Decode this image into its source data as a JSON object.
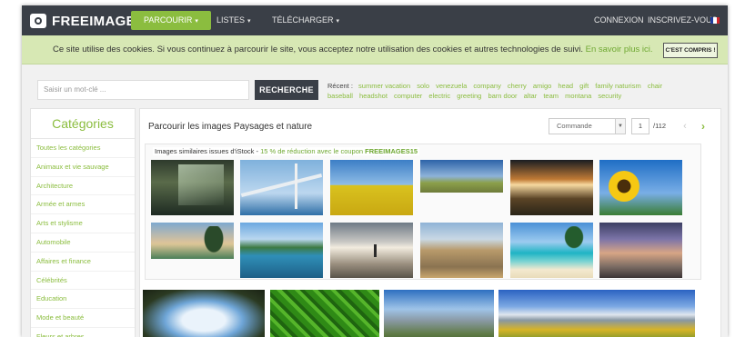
{
  "navbar": {
    "logo": "FREEIMAGES",
    "menu": [
      {
        "label": "PARCOURIR",
        "caret": "▾"
      },
      {
        "label": "LISTES",
        "caret": "▾"
      },
      {
        "label": "TÉLÉCHARGER",
        "caret": "▾"
      }
    ],
    "login": "CONNEXION",
    "signup": "INSCRIVEZ-VOUS"
  },
  "cookie_bar": {
    "text": "Ce site utilise des cookies. Si vous continuez à parcourir le site, vous acceptez notre utilisation des cookies et autres technologies de suivi.",
    "link": "En savoir plus ici.",
    "button": "C'EST COMPRIS !"
  },
  "search": {
    "placeholder": "Saisir un mot-clé ...",
    "button": "RECHERCHE",
    "recent_label": "Récent :",
    "recent_tags": [
      "summer vacation",
      "solo",
      "venezuela",
      "company",
      "cherry",
      "amigo",
      "head",
      "gift",
      "family naturism",
      "chair",
      "baseball",
      "headshot",
      "computer",
      "electric",
      "greeting",
      "barn door",
      "altar",
      "team",
      "montana",
      "security"
    ]
  },
  "sidebar": {
    "title": "Catégories",
    "items": [
      "Toutes les catégories",
      "Animaux et vie sauvage",
      "Architecture",
      "Armée et armes",
      "Arts et stylisme",
      "Automobile",
      "Affaires et finance",
      "Célébrités",
      "Education",
      "Mode et beauté",
      "Fleurs et arbres"
    ]
  },
  "main": {
    "title": "Parcourir les images Paysages et nature",
    "sort": "Commande",
    "page_current": "1",
    "page_total": "/112",
    "istock": {
      "prefix": "Images similaires issues d'iStock - ",
      "discount": "15 % de réduction avec le coupon",
      "code": "FREEIMAGES15"
    }
  },
  "colors": {
    "accent": "#8bbd3f",
    "navbar": "#3a3f47",
    "cookie_bg": "#d7e8b4"
  }
}
